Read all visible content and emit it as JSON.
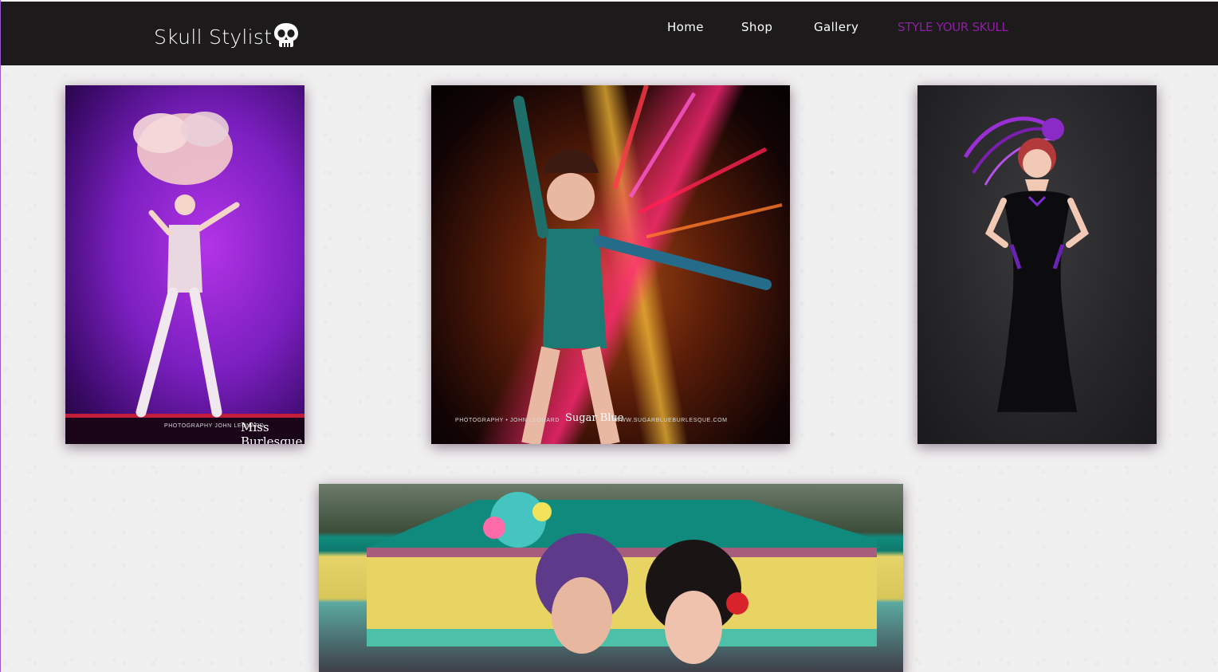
{
  "header": {
    "logo_text": "Skull Stylist",
    "logo_icon": "skull-icon",
    "nav": {
      "home": "Home",
      "shop": "Shop",
      "gallery": "Gallery",
      "style": "STYLE YOUR SKULL"
    }
  },
  "colors": {
    "header_bg": "#1c1a1b",
    "accent": "#8e1fa0",
    "page_bg": "#f1f0f0"
  },
  "gallery": {
    "photo1": {
      "credit": "PHOTOGRAPHY JOHN LEONARD",
      "brand": "Miss Burlesque"
    },
    "photo2": {
      "credit_left": "PHOTOGRAPHY • JOHN LEONARD",
      "brand": "Sugar Blue",
      "credit_right": "WWW.SUGARBLUEBURLESQUE.COM"
    }
  }
}
